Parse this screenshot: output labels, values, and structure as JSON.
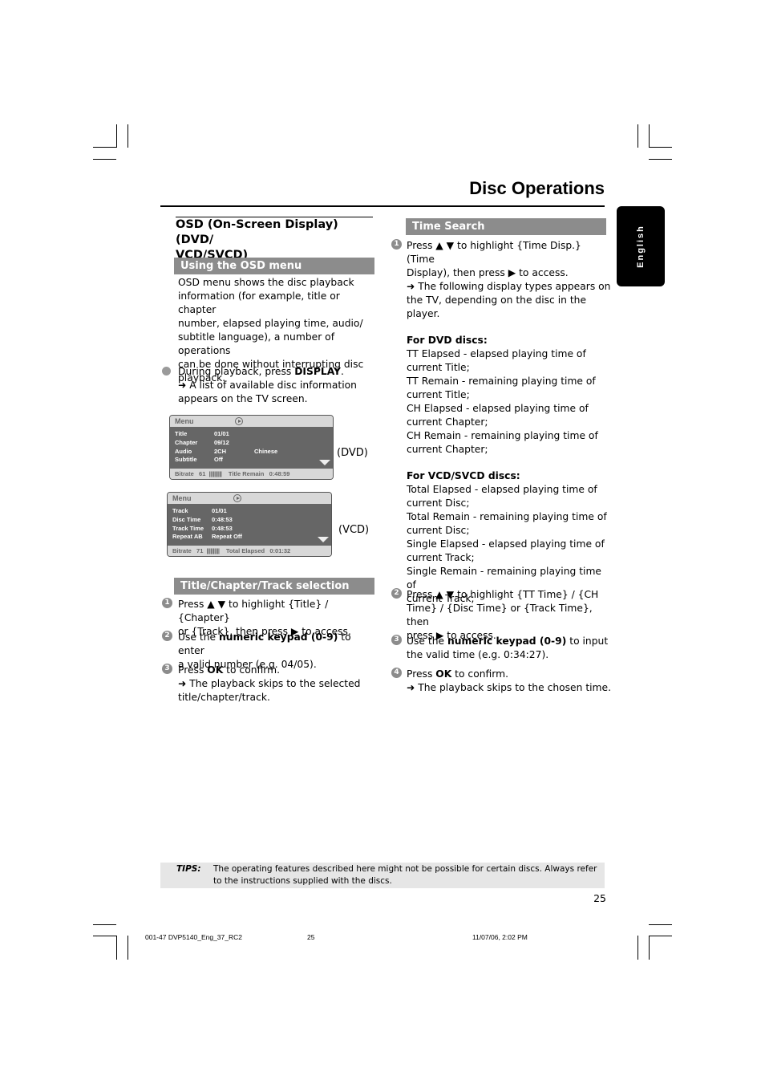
{
  "page": {
    "title": "Disc Operations",
    "language_tab": "English",
    "page_number": "25"
  },
  "left": {
    "section_title": "OSD (On-Screen Display) (DVD/ VCD/SVCD)",
    "section_title_line1": "OSD (On-Screen Display) (DVD/",
    "section_title_line2": "VCD/SVCD)",
    "using_osd": {
      "band": "Using the OSD menu",
      "intro": [
        "OSD menu shows the disc playback",
        "information (for example, title or chapter",
        "number, elapsed playing time, audio/",
        "subtitle language), a number of operations",
        "can be done without interrupting disc",
        "playback."
      ],
      "bullet_pre": "During playback, press ",
      "bullet_bold": "DISPLAY",
      "bullet_post": ".",
      "result_line1": "➜ A list of available disc information",
      "result_line2": "appears on the TV screen."
    },
    "osd_dvd": {
      "header": "Menu",
      "rows": [
        {
          "k": "Title",
          "v": "01/01",
          "x": ""
        },
        {
          "k": "Chapter",
          "v": "09/12",
          "x": ""
        },
        {
          "k": "Audio",
          "v": "2CH",
          "x": "Chinese"
        },
        {
          "k": "Subtitle",
          "v": "Off",
          "x": ""
        }
      ],
      "footer_label": "Bitrate",
      "bitrate": "61",
      "bars": "||||||||||",
      "time_label": "Title Remain",
      "time_value": "0:48:59",
      "caption": "(DVD)"
    },
    "osd_vcd": {
      "header": "Menu",
      "rows": [
        {
          "k": "Track",
          "v": "01/01"
        },
        {
          "k": "Disc Time",
          "v": "0:48:53"
        },
        {
          "k": "Track Time",
          "v": "0:48:53"
        },
        {
          "k": "Repeat AB",
          "v": "Repeat Off"
        }
      ],
      "footer_label": "Bitrate",
      "bitrate": "71",
      "bars": "||||||||||",
      "time_label": "Total Elapsed",
      "time_value": "0:01:32",
      "caption": "(VCD)"
    },
    "title_chapter": {
      "band": "Title/Chapter/Track selection",
      "steps": [
        {
          "n": "1",
          "l1": "Press ▲ ▼ to highlight {Title} / {Chapter}",
          "l2": "or {Track}, then press ▶ to access."
        },
        {
          "n": "2",
          "pre": "Use the ",
          "bold": "numeric keypad (0-9)",
          "post": " to enter",
          "l2": "a valid number (e.g. 04/05)."
        },
        {
          "n": "3",
          "pre": "Press ",
          "bold": "OK",
          "post": " to confirm.",
          "l2": "➜ The playback skips to the selected",
          "l3": "title/chapter/track."
        }
      ]
    }
  },
  "right": {
    "time_search": {
      "band": "Time Search",
      "step1": {
        "n": "1",
        "lines": [
          "Press ▲ ▼ to highlight {Time Disp.} (Time",
          "Display), then press ▶ to access.",
          "➜ The following display types appears on",
          "the TV, depending on the disc in the",
          "player."
        ]
      },
      "dvd_heading": "For DVD discs:",
      "dvd_lines": [
        "TT Elapsed - elapsed playing time of",
        "current Title;",
        "TT Remain - remaining playing time of",
        "current Title;",
        "CH Elapsed - elapsed playing time of",
        "current Chapter;",
        "CH Remain - remaining playing time of",
        "current Chapter;"
      ],
      "vcd_heading": "For VCD/SVCD discs:",
      "vcd_lines": [
        "Total Elapsed - elapsed playing time of",
        "current Disc;",
        "Total Remain - remaining playing time of",
        "current Disc;",
        "Single Elapsed - elapsed playing time of",
        "current Track;",
        "Single Remain - remaining playing time of",
        "current Track;"
      ],
      "step2": {
        "n": "2",
        "lines": [
          "Press ▲ ▼ to highlight {TT Time} / {CH",
          "Time} / {Disc Time} or {Track Time}, then",
          "press ▶ to access."
        ]
      },
      "step3": {
        "n": "3",
        "pre": "Use the ",
        "bold": "numeric keypad (0-9)",
        "post": " to input",
        "l2": "the valid time (e.g. 0:34:27)."
      },
      "step4": {
        "n": "4",
        "pre": "Press ",
        "bold": "OK",
        "post": " to confirm.",
        "l2": "➜ The playback skips to the chosen time."
      }
    }
  },
  "tips": {
    "label": "TIPS:",
    "line1": "The operating features described here might not be possible for certain discs.  Always refer",
    "line2": "to the instructions supplied with the discs."
  },
  "slug": {
    "file": "001-47 DVP5140_Eng_37_RC2",
    "page": "25",
    "date": "11/07/06, 2:02 PM"
  }
}
